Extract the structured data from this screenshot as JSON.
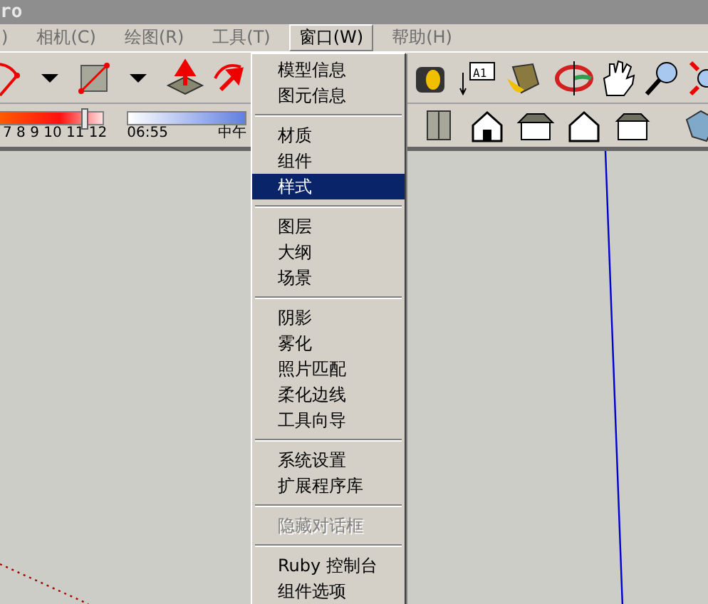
{
  "title_bar": {
    "title": "ro"
  },
  "menu_bar": [
    {
      "label": ")",
      "selected": false
    },
    {
      "label": "相机(C)",
      "selected": false
    },
    {
      "label": "绘图(R)",
      "selected": false
    },
    {
      "label": "工具(T)",
      "selected": false
    },
    {
      "label": "窗口(W)",
      "selected": true
    },
    {
      "label": "帮助(H)",
      "selected": false
    }
  ],
  "text_tool_icon": {
    "label": "A1"
  },
  "shadow_toolbar": {
    "month_scale": "7 8 9 10 11 12",
    "month_slider": {
      "level": 0.8
    },
    "time_start": "06:55",
    "time_noon": "中午"
  },
  "window_menu": {
    "sections": [
      [
        {
          "label": "模型信息",
          "selected": false,
          "disabled": false
        },
        {
          "label": "图元信息",
          "selected": false,
          "disabled": false
        }
      ],
      [
        {
          "label": "材质",
          "selected": false,
          "disabled": false
        },
        {
          "label": "组件",
          "selected": false,
          "disabled": false
        },
        {
          "label": "样式",
          "selected": true,
          "disabled": false
        }
      ],
      [
        {
          "label": "图层",
          "selected": false,
          "disabled": false
        },
        {
          "label": "大纲",
          "selected": false,
          "disabled": false
        },
        {
          "label": "场景",
          "selected": false,
          "disabled": false
        }
      ],
      [
        {
          "label": "阴影",
          "selected": false,
          "disabled": false
        },
        {
          "label": "雾化",
          "selected": false,
          "disabled": false
        },
        {
          "label": "照片匹配",
          "selected": false,
          "disabled": false
        },
        {
          "label": "柔化边线",
          "selected": false,
          "disabled": false
        },
        {
          "label": "工具向导",
          "selected": false,
          "disabled": false
        }
      ],
      [
        {
          "label": "系统设置",
          "selected": false,
          "disabled": false
        },
        {
          "label": "扩展程序库",
          "selected": false,
          "disabled": false
        }
      ],
      [
        {
          "label": "隐藏对话框",
          "selected": false,
          "disabled": true
        }
      ],
      [
        {
          "label": "Ruby 控制台",
          "selected": false,
          "disabled": false
        },
        {
          "label": "组件选项",
          "selected": false,
          "disabled": false
        }
      ]
    ]
  }
}
